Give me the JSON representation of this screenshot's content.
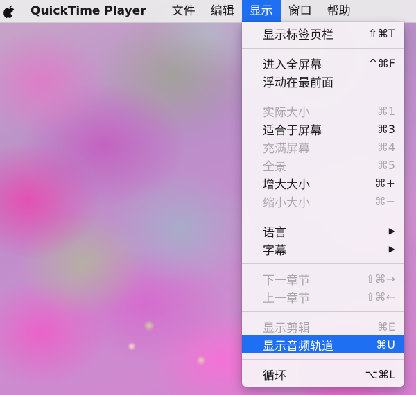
{
  "menubar": {
    "app_name": "QuickTime Player",
    "menus": [
      "文件",
      "编辑",
      "显示",
      "窗口",
      "帮助"
    ],
    "active_menu": "显示"
  },
  "dropdown": {
    "groups": [
      [
        {
          "label": "显示标签页栏",
          "shortcut": "⇧⌘T",
          "disabled": false
        }
      ],
      [
        {
          "label": "进入全屏幕",
          "shortcut": "^⌘F",
          "disabled": false
        },
        {
          "label": "浮动在最前面",
          "shortcut": "",
          "disabled": false
        }
      ],
      [
        {
          "label": "实际大小",
          "shortcut": "⌘1",
          "disabled": true
        },
        {
          "label": "适合于屏幕",
          "shortcut": "⌘3",
          "disabled": false
        },
        {
          "label": "充满屏幕",
          "shortcut": "⌘4",
          "disabled": true
        },
        {
          "label": "全景",
          "shortcut": "⌘5",
          "disabled": true
        },
        {
          "label": "增大大小",
          "shortcut": "⌘+",
          "disabled": false
        },
        {
          "label": "缩小大小",
          "shortcut": "⌘−",
          "disabled": true
        }
      ],
      [
        {
          "label": "语言",
          "submenu": true,
          "disabled": false
        },
        {
          "label": "字幕",
          "submenu": true,
          "disabled": false
        }
      ],
      [
        {
          "label": "下一章节",
          "shortcut": "⇧⌘→",
          "disabled": true
        },
        {
          "label": "上一章节",
          "shortcut": "⇧⌘←",
          "disabled": true
        }
      ],
      [
        {
          "label": "显示剪辑",
          "shortcut": "⌘E",
          "disabled": true
        },
        {
          "label": "显示音频轨道",
          "shortcut": "⌘U",
          "disabled": false,
          "highlighted": true
        }
      ],
      [
        {
          "label": "循环",
          "shortcut": "⌥⌘L",
          "disabled": false
        }
      ]
    ]
  },
  "colors": {
    "accent": "#1f6ff2",
    "disabled_text": "#a8a6a8"
  },
  "icons": {
    "apple": "apple-logo-icon",
    "submenu": "submenu-arrow-icon"
  }
}
